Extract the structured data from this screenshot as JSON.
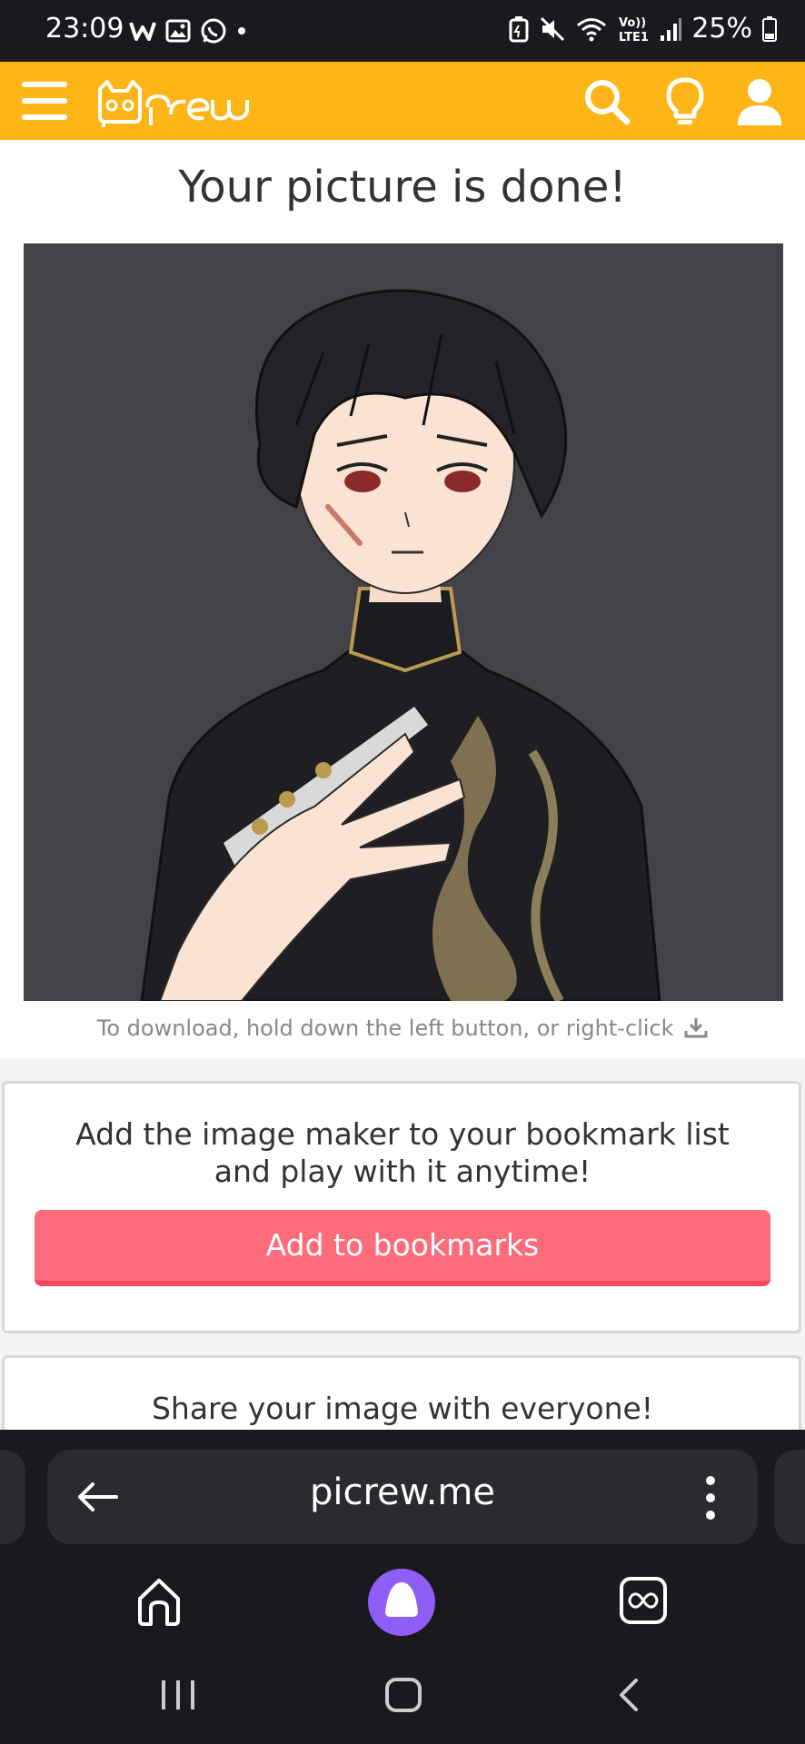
{
  "status_bar": {
    "time": "23:09",
    "notification_icons": [
      "w-app-icon",
      "gallery-icon",
      "whatsapp-icon",
      "dot-icon"
    ],
    "system_icons": [
      "battery-saver-icon",
      "mute-icon",
      "wifi-icon",
      "volte-icon",
      "signal-icon"
    ],
    "volte_label": "Vo)\nLTE1",
    "battery": "25%"
  },
  "header": {
    "brand": "Picrew",
    "color": "#fdb518",
    "icons": [
      "menu-icon",
      "search-icon",
      "lightbulb-icon",
      "user-icon"
    ]
  },
  "page": {
    "title": "Your picture is done!",
    "download_hint": "To download, hold down the left button, or right-click"
  },
  "bookmark_card": {
    "line1": "Add the image maker to your bookmark list",
    "line2": "and play with it anytime!",
    "button_label": "Add to bookmarks",
    "button_color": "#fe6b7b"
  },
  "share_card": {
    "title": "Share your image with everyone!"
  },
  "browser": {
    "url": "picrew.me",
    "icons": [
      "back-arrow-icon",
      "more-vertical-icon",
      "home-icon",
      "assistant-icon",
      "tabs-icon"
    ]
  },
  "system_nav": {
    "icons": [
      "recents-icon",
      "home-button-icon",
      "back-icon"
    ]
  }
}
